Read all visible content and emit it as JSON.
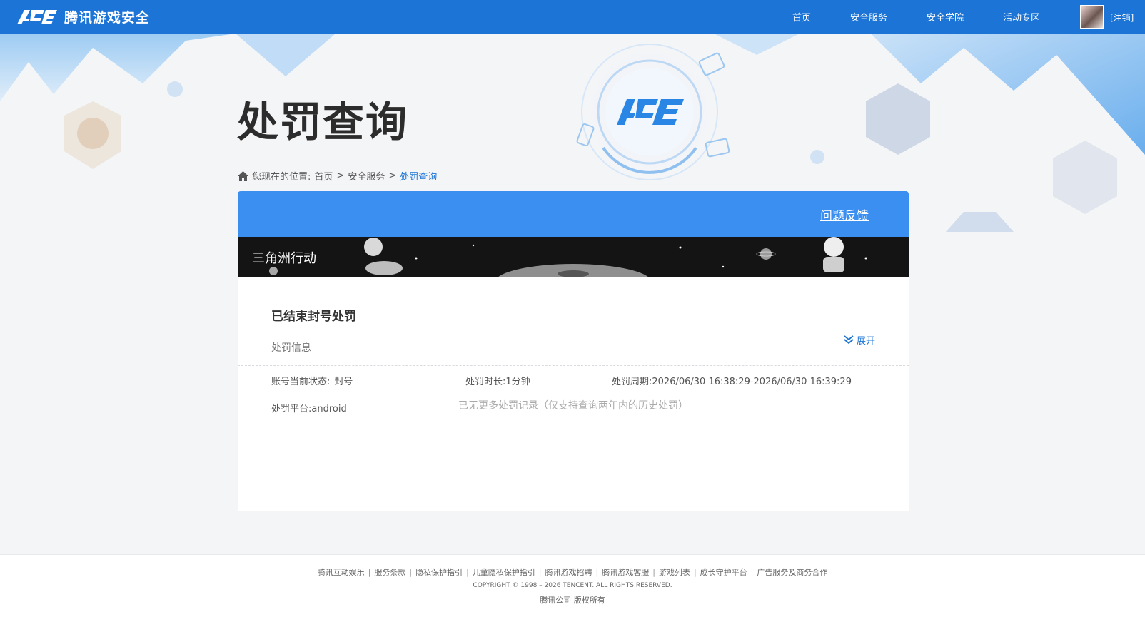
{
  "header": {
    "logo_mark": "ACE",
    "logo_text": "腾讯游戏安全",
    "nav": [
      "首页",
      "安全服务",
      "安全学院",
      "活动专区"
    ],
    "logout": "[注销]"
  },
  "hero": {
    "emblem_text": "ACE",
    "page_title": "处罚查询"
  },
  "breadcrumb": {
    "prefix": "您现在的位置:",
    "items": [
      "首页",
      "安全服务",
      "处罚查询"
    ],
    "separator": ">"
  },
  "card": {
    "feedback": "问题反馈",
    "game_name": "三角洲行动",
    "record": {
      "title": "已结束封号处罚",
      "subtitle": "处罚信息",
      "status_label": "账号当前状态:",
      "status_value": "封号",
      "duration_label": "处罚时长:",
      "duration_value": "1分钟",
      "period_label": "处罚周期:",
      "period_value": "2026/06/30 16:38:29-2026/06/30 16:39:29",
      "platform_label": "处罚平台:",
      "platform_value": "android",
      "expand": "展开"
    },
    "no_more": "已无更多处罚记录（仅支持查询两年内的历史处罚）"
  },
  "footer": {
    "links": [
      "腾讯互动娱乐",
      "服务条款",
      "隐私保护指引",
      "儿童隐私保护指引",
      "腾讯游戏招聘",
      "腾讯游戏客服",
      "游戏列表",
      "成长守护平台",
      "广告服务及商务合作"
    ],
    "copyright": "COPYRIGHT © 1998 – 2026 TENCENT. ALL RIGHTS RESERVED.",
    "rights": "腾讯公司 版权所有"
  },
  "colors": {
    "nav_bg": "#1c74d6",
    "card_header_bg": "#3a8ff0",
    "accent": "#1c74d6"
  }
}
